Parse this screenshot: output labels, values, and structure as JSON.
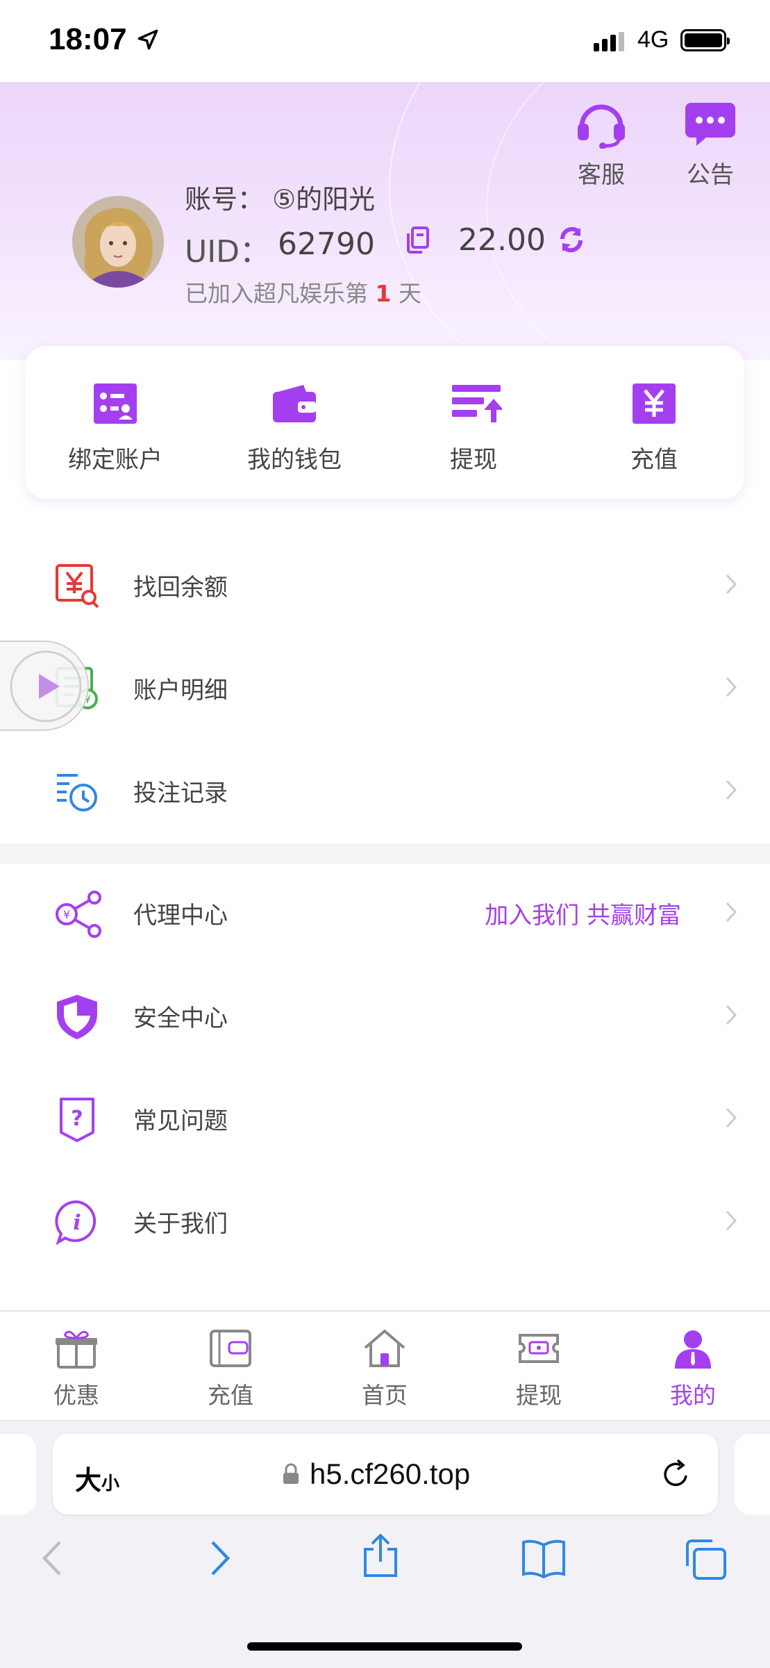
{
  "status_bar": {
    "time": "18:07",
    "network": "4G"
  },
  "header": {
    "customer_service_label": "客服",
    "notice_label": "公告",
    "account_label": "账号：",
    "account_name": "⑤的阳光",
    "uid_label": "UID：",
    "uid_value": "62790",
    "balance": "22.00",
    "days_prefix": "已加入超凡娱乐第",
    "days_count": "1",
    "days_suffix": "天"
  },
  "quick_actions": [
    {
      "label": "绑定账户",
      "icon": "id-card-icon"
    },
    {
      "label": "我的钱包",
      "icon": "wallet-icon"
    },
    {
      "label": "提现",
      "icon": "withdraw-icon"
    },
    {
      "label": "充值",
      "icon": "yen-recharge-icon"
    }
  ],
  "menu_group_1": [
    {
      "label": "找回余额",
      "icon": "balance-search-icon"
    },
    {
      "label": "账户明细",
      "icon": "account-detail-icon"
    },
    {
      "label": "投注记录",
      "icon": "bet-history-icon"
    }
  ],
  "menu_group_2": [
    {
      "label": "代理中心",
      "extra": "加入我们 共赢财富",
      "icon": "agent-share-icon"
    },
    {
      "label": "安全中心",
      "icon": "shield-icon"
    },
    {
      "label": "常见问题",
      "icon": "question-icon"
    },
    {
      "label": "关于我们",
      "icon": "info-icon"
    }
  ],
  "tabbar": [
    {
      "label": "优惠",
      "icon": "gift-icon"
    },
    {
      "label": "充值",
      "icon": "wallet-card-icon"
    },
    {
      "label": "首页",
      "icon": "home-icon"
    },
    {
      "label": "提现",
      "icon": "ticket-icon"
    },
    {
      "label": "我的",
      "icon": "user-icon",
      "active": true
    }
  ],
  "browser": {
    "text_size_label": "大",
    "text_size_small": "小",
    "url": "h5.cf260.top"
  },
  "colors": {
    "accent": "#a43ff0",
    "red": "#e53935",
    "green": "#4caf50",
    "blue": "#2f88e6"
  }
}
